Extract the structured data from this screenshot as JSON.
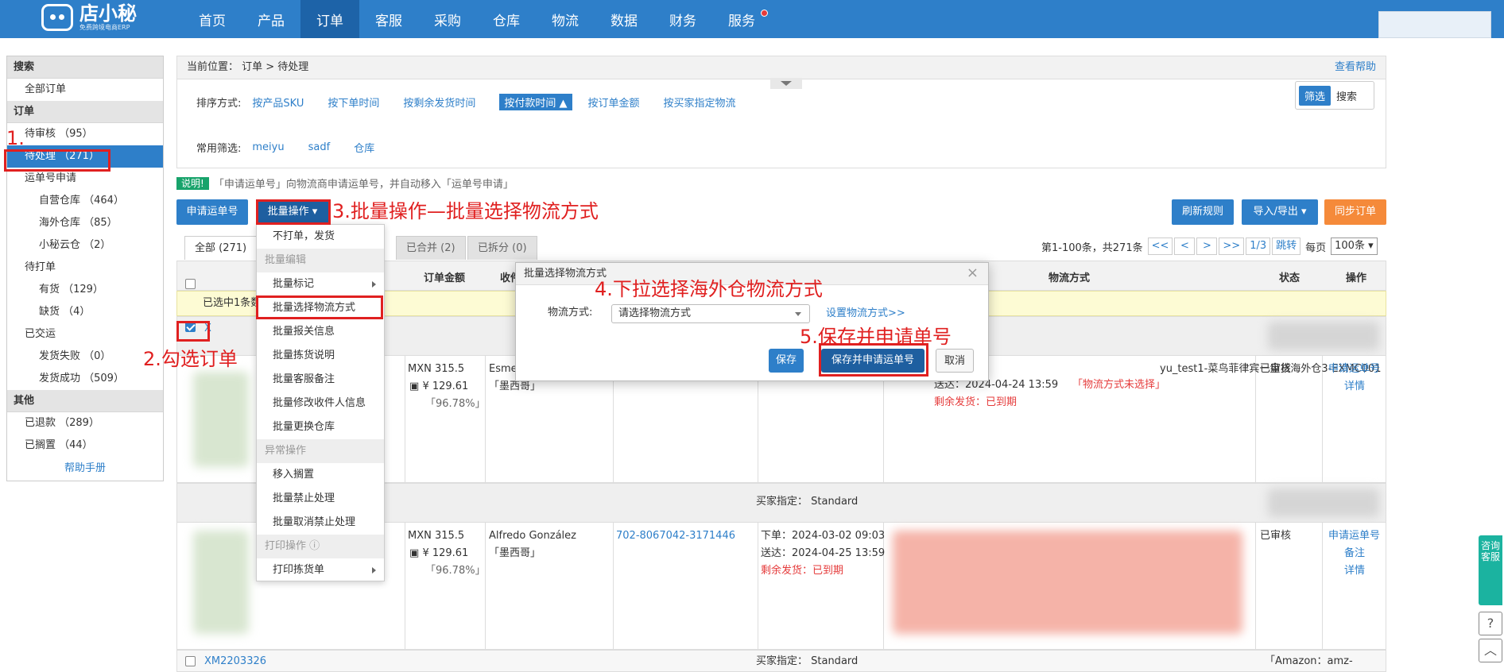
{
  "header": {
    "logo_title": "店小秘",
    "logo_sub": "免费跨境电商ERP",
    "nav": [
      "首页",
      "产品",
      "订单",
      "客服",
      "采购",
      "仓库",
      "物流",
      "数据",
      "财务",
      "服务"
    ],
    "active_nav": "订单"
  },
  "sidebar": {
    "search_head": "搜索",
    "all_orders": "全部订单",
    "order_head": "订单",
    "pending_review": "待审核 （95）",
    "pending_process": "待处理 （271）",
    "waybill_apply": "运单号申请",
    "self_wh": "自营仓库 （464）",
    "overseas_wh": "海外仓库 （85）",
    "xm_cloud": "小秘云仓 （2）",
    "to_print": "待打单",
    "in_stock": "有货 （129）",
    "out_stock": "缺货 （4）",
    "shipped": "已交运",
    "ship_fail": "发货失败 （0）",
    "ship_ok": "发货成功 （509）",
    "other_head": "其他",
    "refunded": "已退款 （289）",
    "shelved": "已搁置 （44）",
    "help": "帮助手册"
  },
  "breadcrumb": {
    "text": "当前位置：  订单 > 待处理",
    "help": "查看帮助"
  },
  "filters": {
    "sort_label": "排序方式:",
    "sorts": [
      "按产品SKU",
      "按下单时间",
      "按剩余发货时间",
      "按付款时间 ▲",
      "按订单金额",
      "按买家指定物流"
    ],
    "active_sort": "按付款时间 ▲",
    "common_label": "常用筛选:",
    "commons": [
      "meiyu",
      "sadf",
      "仓库"
    ],
    "toggle_filter": "筛选",
    "toggle_search": "搜索"
  },
  "note": {
    "tag": "说明!",
    "text": "「申请运单号」向物流商申请运单号，并自动移入「运单号申请」"
  },
  "actions": {
    "apply_waybill": "申请运单号",
    "batch_ops": "批量操作 ▾",
    "refresh_rules": "刷新规则",
    "import_export": "导入/导出 ▾",
    "sync_orders": "同步订单"
  },
  "tabs": [
    "全部 (271)",
    "已合并 (2)",
    "已拆分 (0)"
  ],
  "pager": {
    "info": "第1-100条，共271条",
    "first": "<<",
    "prev": "<",
    "next": ">",
    "last": ">>",
    "page": "1/3",
    "jump": "跳转",
    "per_page_label": "每页",
    "per_page": "100条 ▾"
  },
  "table": {
    "headers": {
      "amount": "订单金额",
      "recv": "收件",
      "logistics": "物流方式",
      "status": "状态",
      "ops": "操作"
    },
    "selected_text": "已选中1条数据",
    "rows": [
      {
        "order_no_partial": "X",
        "amount": "MXN 315.5",
        "cost": "¥ 129.61",
        "margin": "「96.78%」",
        "recv_name": "Esme",
        "recv_country": "「墨西哥」",
        "ship_to": "送达：2024-04-24 13:59",
        "remain": "剩余发货：已到期",
        "logistics": "yu_test1-菜鸟菲律宾一盘货海外仓3-EXMC001",
        "logistics_warn": "「物流方式未选择」",
        "status": "已审核",
        "op1": "申请运单号",
        "op2": "详情"
      },
      {
        "buyer_assign": "买家指定：  Standard",
        "amount": "MXN 315.5",
        "cost": "¥ 129.61",
        "margin": "「96.78%」",
        "recv_name": "Alfredo González",
        "recv_country": "「墨西哥」",
        "phone": "702-8067042-3171446",
        "order_time": "下单：2024-03-02 09:03",
        "ship_to": "送达：2024-04-25 13:59",
        "remain": "剩余发货：已到期",
        "status": "已审核",
        "op1": "申请运单号",
        "op2": "备注",
        "op3": "详情"
      }
    ],
    "last_row": {
      "order_no": "XM2203326",
      "buyer_assign": "买家指定：  Standard",
      "store": "「Amazon：amz-sunshin"
    }
  },
  "menu": {
    "items": [
      {
        "label": "不打单，发货",
        "type": "item"
      },
      {
        "label": "批量编辑",
        "type": "group"
      },
      {
        "label": "批量标记",
        "type": "item",
        "arrow": true
      },
      {
        "label": "批量选择物流方式",
        "type": "item"
      },
      {
        "label": "批量报关信息",
        "type": "item"
      },
      {
        "label": "批量拣货说明",
        "type": "item"
      },
      {
        "label": "批量客服备注",
        "type": "item"
      },
      {
        "label": "批量修改收件人信息",
        "type": "item"
      },
      {
        "label": "批量更换仓库",
        "type": "item"
      },
      {
        "label": "异常操作",
        "type": "group"
      },
      {
        "label": "移入搁置",
        "type": "item"
      },
      {
        "label": "批量禁止处理",
        "type": "item"
      },
      {
        "label": "批量取消禁止处理",
        "type": "item"
      },
      {
        "label": "打印操作 ⓘ",
        "type": "group"
      },
      {
        "label": "打印拣货单",
        "type": "item",
        "arrow": true
      }
    ]
  },
  "modal": {
    "title": "批量选择物流方式",
    "close": "×",
    "field_label": "物流方式:",
    "select_value": "请选择物流方式",
    "set_link": "设置物流方式>>",
    "save": "保存",
    "save_apply": "保存并申请运单号",
    "cancel": "取消"
  },
  "annotations": {
    "a1": "1.",
    "a2": "2.勾选订单",
    "a3": "3.批量操作—批量选择物流方式",
    "a4": "4.下拉选择海外仓物流方式",
    "a5": "5.保存并申请单号"
  },
  "float": {
    "cs": "咨询客服",
    "help": "?",
    "top": "︿"
  },
  "colors": {
    "primary": "#2e7fc9",
    "orange": "#f58a3a",
    "annotation": "#e02020",
    "cs": "#1bb3a0"
  }
}
